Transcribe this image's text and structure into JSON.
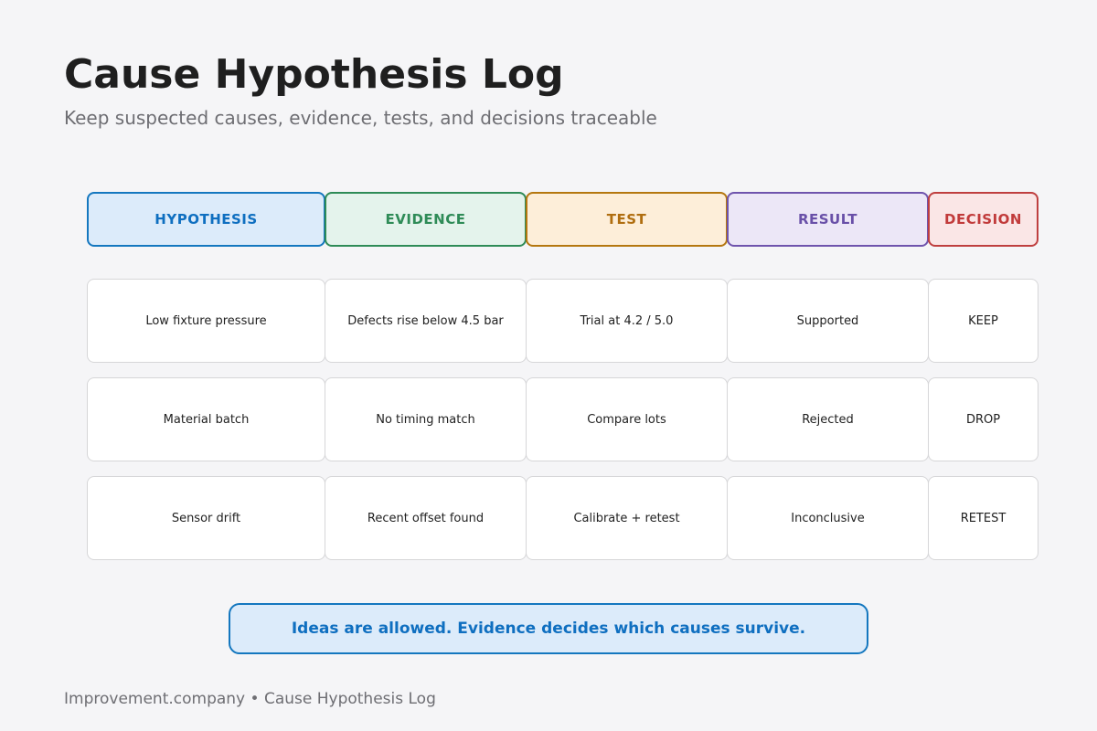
{
  "title": "Cause Hypothesis Log",
  "subtitle": "Keep suspected causes, evidence, tests, and decisions traceable",
  "columns": [
    "HYPOTHESIS",
    "EVIDENCE",
    "TEST",
    "RESULT",
    "DECISION"
  ],
  "column_colors": {
    "hypothesis": "#0f6fc0",
    "evidence": "#2e8b57",
    "test": "#b06e10",
    "result": "#6950a8",
    "decision": "#c13b3b"
  },
  "rows": [
    [
      "Low fixture pressure",
      "Defects rise below 4.5 bar",
      "Trial at 4.2 / 5.0",
      "Supported",
      "KEEP"
    ],
    [
      "Material batch",
      "No timing match",
      "Compare lots",
      "Rejected",
      "DROP"
    ],
    [
      "Sensor drift",
      "Recent offset found",
      "Calibrate + retest",
      "Inconclusive",
      "RETEST"
    ]
  ],
  "callout": "Ideas are allowed. Evidence decides which causes survive.",
  "footer": "Improvement.company • Cause Hypothesis Log"
}
